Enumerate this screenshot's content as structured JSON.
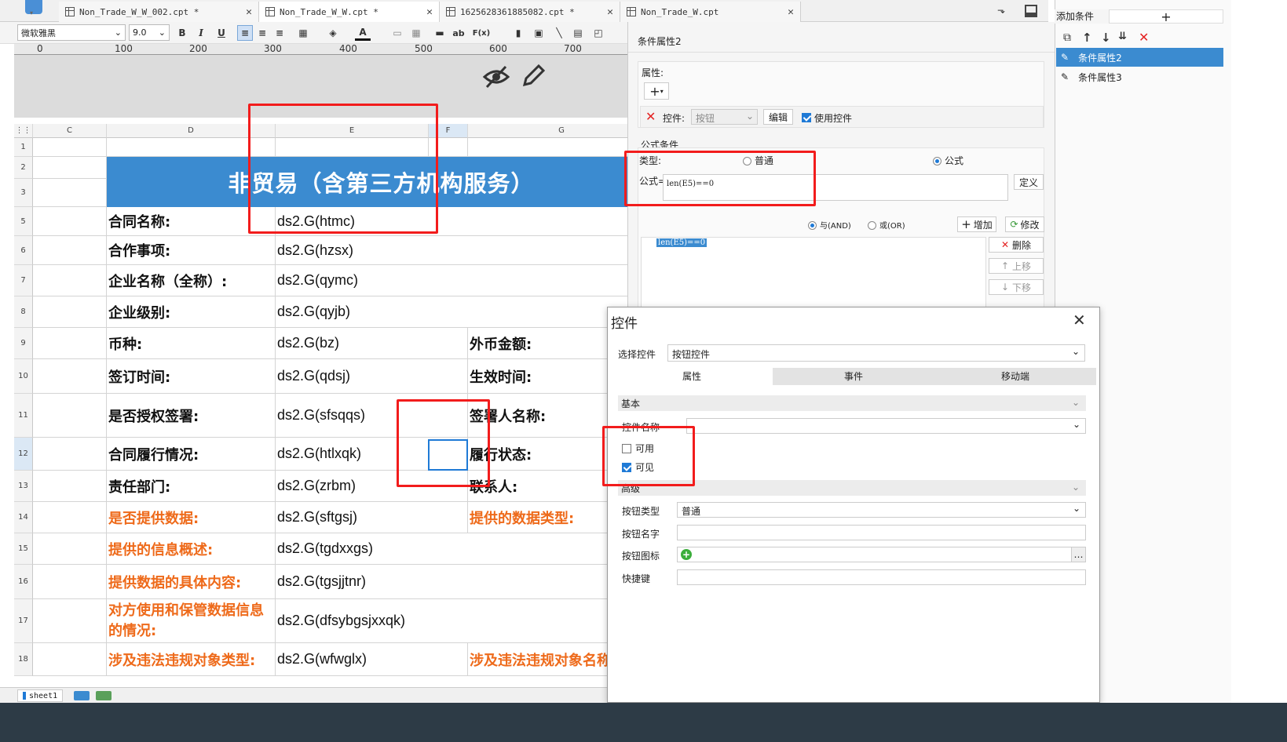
{
  "tabs": [
    {
      "label": "Non_Trade_W_W_002.cpt *"
    },
    {
      "label": "Non_Trade_W_W.cpt *"
    },
    {
      "label": "1625628361885082.cpt *"
    },
    {
      "label": "Non_Trade_W.cpt"
    }
  ],
  "toolbar": {
    "font": "微软雅黑",
    "size": "9.0",
    "bold": "B",
    "italic": "I",
    "underline": "U",
    "text_a": "A",
    "ab": "ab",
    "fx": "F(x)"
  },
  "ruler": [
    "0",
    "100",
    "200",
    "300",
    "400",
    "500",
    "600",
    "700"
  ],
  "grid": {
    "columns": [
      "C",
      "D",
      "E",
      "F",
      "G"
    ],
    "banner": "非贸易（含第三方机构服务）",
    "rows": [
      {
        "n": "1"
      },
      {
        "n": "2"
      },
      {
        "n": "3"
      },
      {
        "n": "5",
        "label": "合同名称:",
        "value": "ds2.G(htmc)"
      },
      {
        "n": "6",
        "label": "合作事项:",
        "value": "ds2.G(hzsx)"
      },
      {
        "n": "7",
        "label": "企业名称（全称）:",
        "value": "ds2.G(qymc)"
      },
      {
        "n": "8",
        "label": "企业级别:",
        "value": "ds2.G(qyjb)"
      },
      {
        "n": "9",
        "label": "币种:",
        "value": "ds2.G(bz)",
        "g": "外币金额:"
      },
      {
        "n": "10",
        "label": "签订时间:",
        "value": "ds2.G(qdsj)",
        "g": "生效时间:"
      },
      {
        "n": "11",
        "label": "是否授权签署:",
        "value": "ds2.G(sfsqqs)",
        "g": "签署人名称:"
      },
      {
        "n": "12",
        "label": "合同履行情况:",
        "value": "ds2.G(htlxqk)",
        "g": "履行状态:"
      },
      {
        "n": "13",
        "label": "责任部门:",
        "value": "ds2.G(zrbm)",
        "g": "联系人:"
      },
      {
        "n": "14",
        "label": "是否提供数据:",
        "value": "ds2.G(sftgsj)",
        "g": "提供的数据类型:"
      },
      {
        "n": "15",
        "label": "提供的信息概述:",
        "value": "ds2.G(tgdxxgs)"
      },
      {
        "n": "16",
        "label": "提供数据的具体内容:",
        "value": "ds2.G(tgsjjtnr)"
      },
      {
        "n": "17",
        "label": "对方使用和保管数据信息的情况:",
        "label1": "对方使用和保管数据信息",
        "label2": "的情况:",
        "value": "ds2.G(dfsybgsjxxqk)"
      },
      {
        "n": "18",
        "label": "涉及违法违规对象类型:",
        "value": "ds2.G(wfwglx)",
        "g": "涉及违法违规对象名称"
      }
    ],
    "sheet": "sheet1"
  },
  "cond_panel": {
    "title": "条件属性2",
    "attr_label": "属性:",
    "control_label": "控件:",
    "control_value": "按钮",
    "edit": "编辑",
    "use_control": "使用控件",
    "formula_cond": "公式条件",
    "type_label": "类型:",
    "normal": "普通",
    "formula": "公式",
    "formula_label": "公式=",
    "formula_value": "len(E5)==0",
    "define": "定义",
    "and": "与(AND)",
    "or": "或(OR)",
    "add": "增加",
    "modify": "修改",
    "list_item": "len(E5)==0",
    "delete": "删除",
    "up": "上移",
    "down": "下移"
  },
  "cond_list": {
    "header": "添加条件",
    "items": [
      "条件属性2",
      "条件属性3"
    ]
  },
  "dialog": {
    "title": "控件",
    "select_label": "选择控件",
    "select_value": "按钮控件",
    "tabs": [
      "属性",
      "事件",
      "移动端"
    ],
    "basic": "基本",
    "name_label": "控件名称",
    "enabled": "可用",
    "visible": "可见",
    "advanced": "高级",
    "btn_type_label": "按钮类型",
    "btn_type_value": "普通",
    "btn_name_label": "按钮名字",
    "btn_icon_label": "按钮图标",
    "shortcut_label": "快捷键"
  },
  "colors": {
    "banner": "#3b8bd0",
    "highlight": "#f21c1c",
    "accent": "#1f7ad6",
    "orange_label": "#ee6a1a"
  }
}
